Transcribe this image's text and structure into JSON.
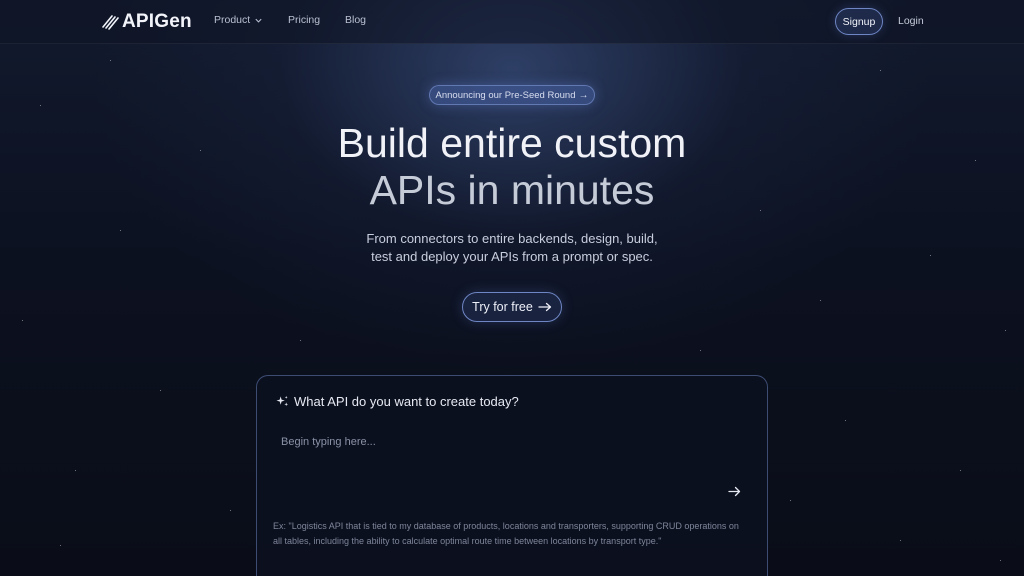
{
  "brand": {
    "name": "APIGen",
    "icon": "speed-lines-icon"
  },
  "nav": {
    "items": [
      {
        "label": "Product",
        "has_dropdown": true
      },
      {
        "label": "Pricing",
        "has_dropdown": false
      },
      {
        "label": "Blog",
        "has_dropdown": false
      }
    ],
    "signup_label": "Signup",
    "login_label": "Login"
  },
  "hero": {
    "announcement": "Announcing our Pre-Seed Round",
    "title_line1": "Build entire custom",
    "title_line2": "APIs in minutes",
    "subtitle_line1": "From connectors to entire backends, design, build,",
    "subtitle_line2": "test and deploy your APIs from a prompt or spec.",
    "cta_label": "Try for free"
  },
  "prompt": {
    "heading": "What API do you want to create today?",
    "input_value": "",
    "placeholder": "Begin typing here...",
    "example": "Ex: \"Logistics API that is tied to my database of products, locations and transporters, supporting CRUD operations on all tables, including the ability to calculate optimal route time between locations by transport type.\""
  },
  "colors": {
    "background": "#0a0d18",
    "accent_border": "#6f86c4",
    "badge_bg": "#465fa0"
  }
}
